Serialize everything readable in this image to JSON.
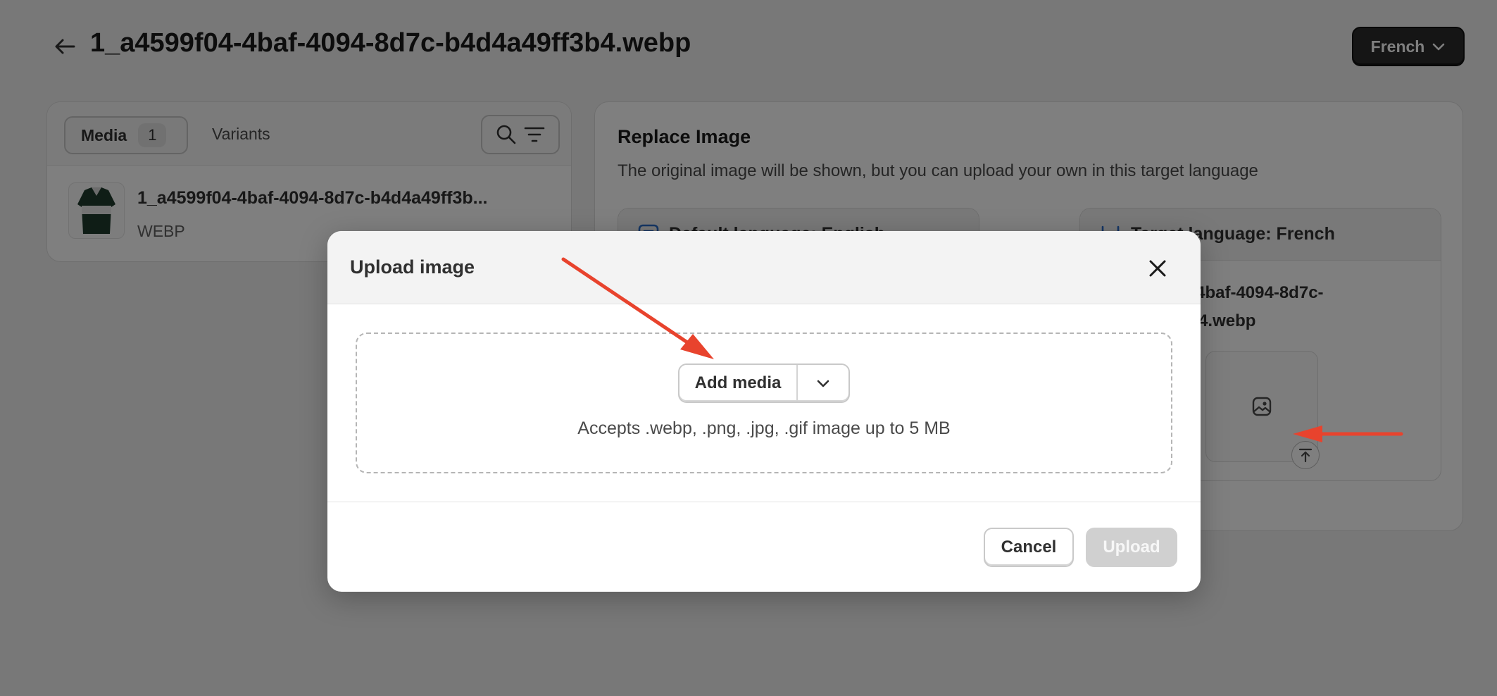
{
  "header": {
    "title": "1_a4599f04-4baf-4094-8d7c-b4d4a49ff3b4.webp",
    "language_button": "French"
  },
  "left_panel": {
    "tab_media_label": "Media",
    "tab_media_count": "1",
    "tab_variants_label": "Variants",
    "media_item": {
      "name": "1_a4599f04-4baf-4094-8d7c-b4d4a49ff3b...",
      "type": "WEBP"
    }
  },
  "right_panel": {
    "title": "Replace Image",
    "description": "The original image will be shown, but you can upload your own in this target language",
    "default_language_header": "Default language: English",
    "target_language_header": "Target language: French",
    "target_file_line1": "1_a4599f04-4baf-4094-8d7c-",
    "target_file_line2": "b4d4a49ff3b4.webp"
  },
  "modal": {
    "title": "Upload image",
    "add_media_label": "Add media",
    "accepts_text": "Accepts .webp, .png, .jpg, .gif image up to 5 MB",
    "cancel_label": "Cancel",
    "upload_label": "Upload"
  },
  "colors": {
    "annotation_arrow": "#e8432d",
    "language_button_bg": "#2b2b2b",
    "upload_disabled_bg": "#d0d0d0"
  },
  "icons": [
    "back-arrow-icon",
    "chevron-down-icon",
    "search-icon",
    "filter-icon",
    "close-icon",
    "image-icon",
    "upload-icon"
  ]
}
